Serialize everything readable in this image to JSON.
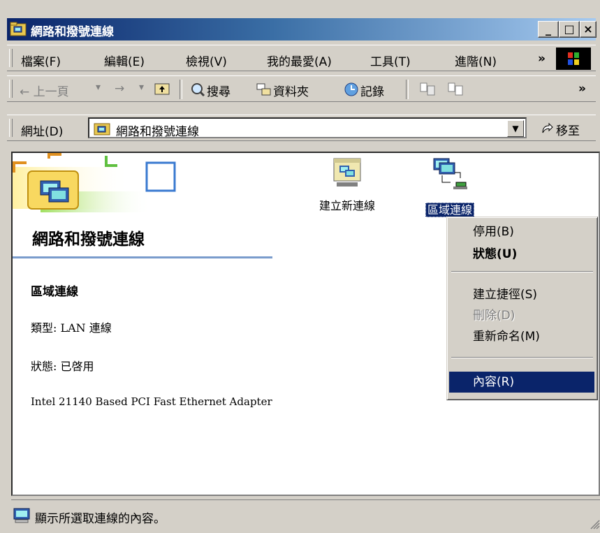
{
  "window": {
    "title": "網路和撥號連線",
    "minimize": "_",
    "maximize": "□",
    "close": "×"
  },
  "menubar": {
    "items": [
      "檔案(F)",
      "編輯(E)",
      "檢視(V)",
      "我的最愛(A)",
      "工具(T)",
      "進階(N)"
    ],
    "chevron": "»"
  },
  "toolbar": {
    "back": "← 上一頁",
    "back_drop": "▾",
    "forward": "→",
    "forward_drop": "▾",
    "search": "搜尋",
    "folders": "資料夾",
    "history": "記錄",
    "chevron": "»"
  },
  "addressbar": {
    "label": "網址(D)",
    "value": "網路和撥號連線",
    "dropdown": "▼",
    "go": "移至"
  },
  "leftpanel": {
    "title": "網路和撥號連線",
    "selected_name": "區域連線",
    "type_line": "類型: LAN 連線",
    "status_line": "狀態: 已啓用",
    "device": "Intel 21140 Based PCI Fast Ethernet Adapter"
  },
  "icons": {
    "new_connection": "建立新連線",
    "local_connection": "區域連線"
  },
  "context_menu": {
    "disable": "停用(B)",
    "status": "狀態(U)",
    "create_shortcut": "建立捷徑(S)",
    "delete": "刪除(D)",
    "rename": "重新命名(M)",
    "properties": "內容(R)"
  },
  "statusbar": {
    "text": "顯示所選取連線的內容。"
  },
  "colors": {
    "title_active": "#0a246a",
    "face": "#d4d0c8",
    "selection": "#0a246a"
  }
}
